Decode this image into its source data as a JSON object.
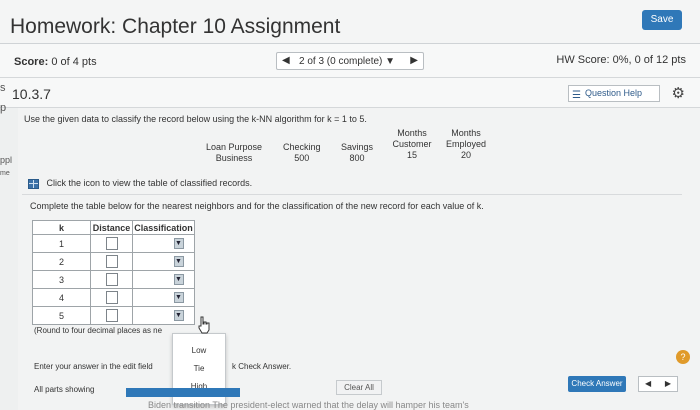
{
  "header": {
    "title": "Homework: Chapter 10 Assignment",
    "save_label": "Save"
  },
  "scorebar": {
    "score_label": "Score:",
    "score_value": "0 of 4 pts",
    "nav_label": "2 of 3 (0 complete) ▼",
    "hw_score": "HW Score: 0%, 0 of 12 pts"
  },
  "question": {
    "number": "10.3.7",
    "help_label": "Question Help"
  },
  "intro": "Use the given data to classify the record below using the k-NN algorithm for k = 1 to 5.",
  "record": [
    {
      "header": "Loan Purpose",
      "value": "Business"
    },
    {
      "header": "Checking",
      "value": "500"
    },
    {
      "header": "Savings",
      "value": "800"
    },
    {
      "header": "Months Customer",
      "value": "15"
    },
    {
      "header": "Months Employed",
      "value": "20"
    }
  ],
  "view_link": "Click the icon to view the table of classified records.",
  "complete_text": "Complete the table below for the nearest neighbors and for the classification of the new record for each value of k.",
  "table": {
    "headers": [
      "k",
      "Distance",
      "Classification"
    ],
    "rows": [
      {
        "k": "1"
      },
      {
        "k": "2"
      },
      {
        "k": "3"
      },
      {
        "k": "4"
      },
      {
        "k": "5"
      }
    ]
  },
  "rounding": "(Round to four decimal places as ne",
  "dropdown_options": [
    "Low",
    "Tie",
    "High"
  ],
  "enter_text": "Enter your answer in the edit field",
  "enter_tail": "k Check Answer.",
  "all_parts": "All parts showing",
  "clear_all": "Clear All",
  "check_answer": "Check Answer",
  "ticker": "Biden transition  The president-elect warned that the delay will hamper his team's",
  "edge_left": {
    "s": "s",
    "p": "p",
    "ppl": "ppl",
    "me": "me"
  },
  "colors": {
    "accent": "#2f78b8",
    "help": "#e09a2a"
  }
}
